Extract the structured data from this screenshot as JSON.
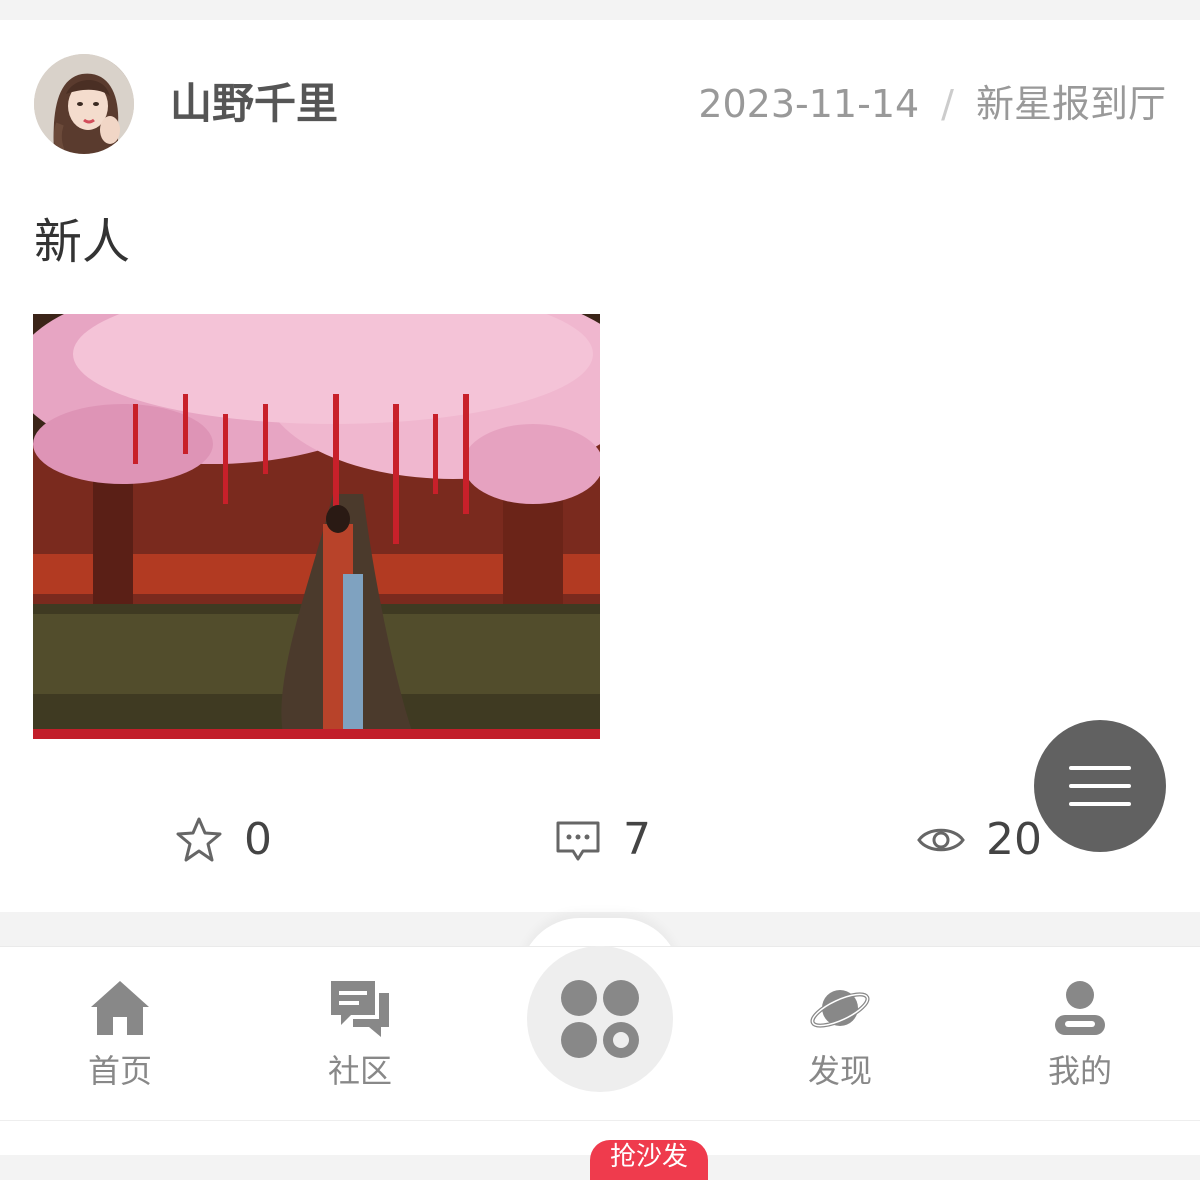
{
  "post": {
    "username": "山野千里",
    "date": "2023-11-14",
    "separator": "/",
    "channel": "新星报到厅",
    "text": "新人",
    "stats": {
      "favorites": "0",
      "comments": "7",
      "views": "20"
    }
  },
  "tabbar": {
    "items": [
      {
        "label": "首页",
        "icon": "home-icon"
      },
      {
        "label": "社区",
        "icon": "chat-bubbles-icon"
      },
      {
        "label": "",
        "icon": "apps-grid-icon"
      },
      {
        "label": "发现",
        "icon": "planet-icon"
      },
      {
        "label": "我的",
        "icon": "user-icon"
      }
    ],
    "badge": "抢沙发"
  },
  "colors": {
    "accent_red": "#ef3b4d",
    "fab_gray": "#616161",
    "text_gray": "#888888"
  }
}
